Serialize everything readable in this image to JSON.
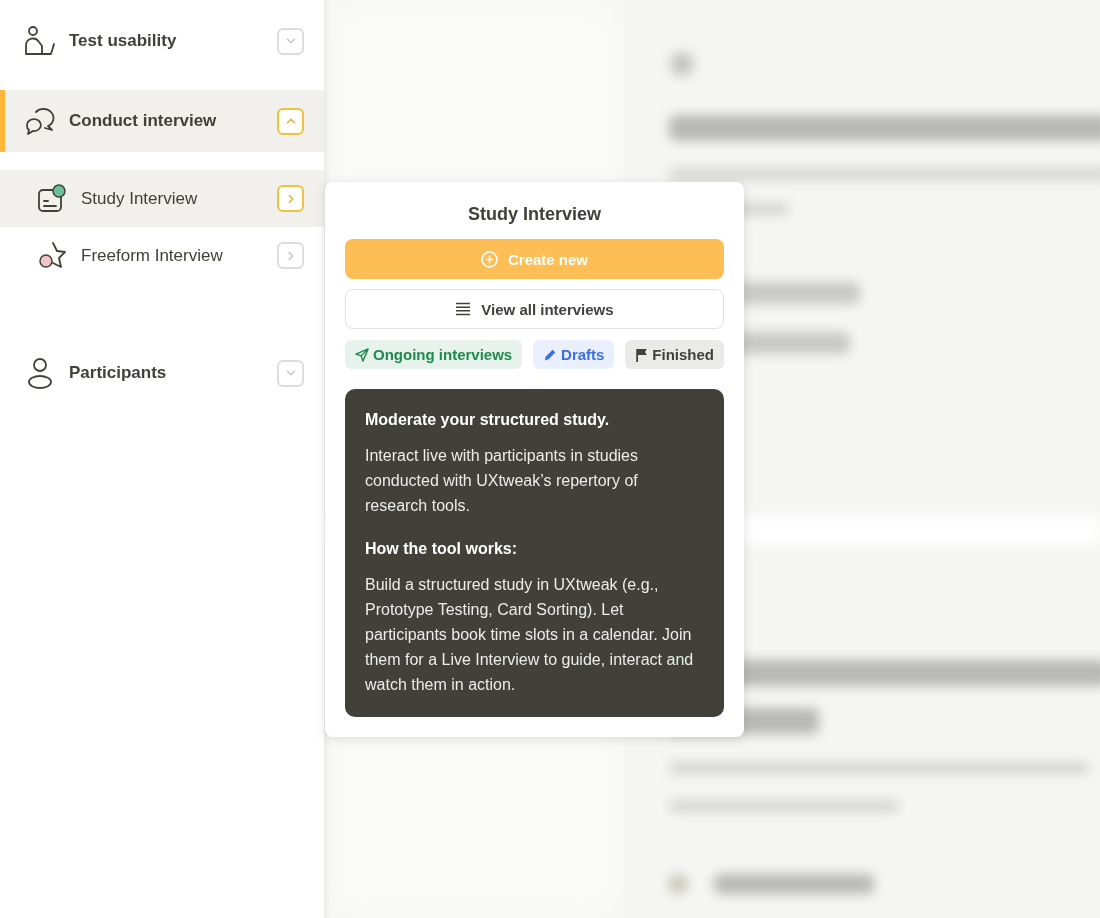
{
  "nav": [
    {
      "label": "Test usability",
      "selected": false,
      "expanded": false
    },
    {
      "label": "Conduct interview",
      "selected": true,
      "expanded": true,
      "children": [
        {
          "label": "Study Interview",
          "selected": true
        },
        {
          "label": "Freeform Interview",
          "selected": false
        }
      ]
    },
    {
      "label": "Participants",
      "selected": false,
      "expanded": false
    }
  ],
  "popover": {
    "title": "Study Interview",
    "actions": [
      {
        "label": "Create new",
        "kind": "primary"
      },
      {
        "label": "View all interviews",
        "kind": "secondary"
      }
    ],
    "filters": [
      {
        "label": "Ongoing interviews",
        "color": "#1e8a4c"
      },
      {
        "label": "Drafts",
        "color": "#3b6fe6"
      },
      {
        "label": "Finished",
        "color": "#41413a"
      }
    ],
    "info": [
      {
        "heading": "Moderate your structured study.",
        "text": "Interact live with participants in studies conducted with UXtweak’s repertory of research tools."
      },
      {
        "heading": "How the tool works:",
        "text": "Build a structured study in UXtweak (e.g., Prototype Testing, Card Sorting). Let participants book time slots in a calendar. Join them for a Live Interview to guide, interact and watch them in action."
      }
    ]
  }
}
